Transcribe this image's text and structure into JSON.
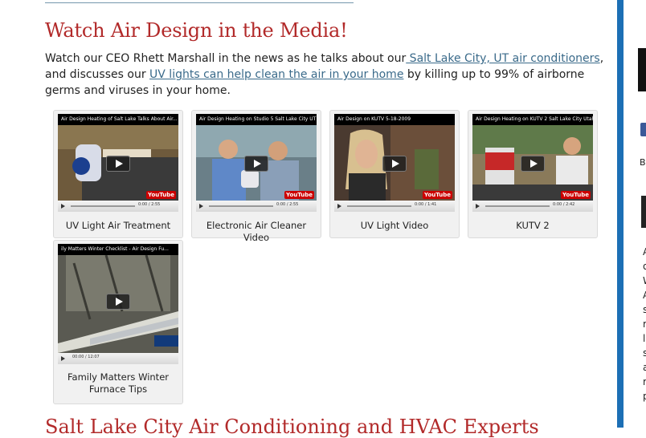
{
  "section": {
    "title": "Watch Air Design in the Media!",
    "intro_start": "Watch our CEO Rhett Marshall in the news as he talks about our",
    "link_ac": " Salt Lake City, UT air conditioners",
    "intro_mid": ", and discusses our ",
    "link_uv": "UV lights can help clean the air in your home",
    "intro_end": " by killing up to 99% of airborne germs and viruses in your home."
  },
  "videos": [
    {
      "title": "Air Design Heating of Salt Lake Talks About Air...",
      "caption": "UV Light Air Treatment",
      "time": "0:00 / 2:55"
    },
    {
      "title": "Air Design Heating on Studio 5 Salt Lake City UT",
      "caption": "Electronic Air Cleaner Video",
      "time": "0:00 / 2:55"
    },
    {
      "title": "Air Design on KUTV 5-18-2009",
      "caption": "UV Light Video",
      "time": "0:00 / 1:41"
    },
    {
      "title": "Air Design Heating on KUTV 2 Salt Lake City Utah",
      "caption": "KUTV 2",
      "time": "0:00 / 2:42"
    },
    {
      "title": "ily Matters Winter Checklist - Air Design Fu...",
      "caption": "Family Matters Winter Furnace Tips",
      "time": "00:00 / 12:07"
    }
  ],
  "youtube_label": "YouTube",
  "next_heading": "Salt Lake City Air Conditioning and HVAC Experts",
  "sidebar": {
    "b_letter": "B",
    "letters": [
      "A",
      "o",
      "W",
      "A",
      "s",
      "r",
      "l",
      "s",
      "a",
      "r",
      "p"
    ]
  },
  "colors": {
    "heading": "#b22a2a",
    "link": "#3a6a8a",
    "sidebar_border": "#1c6fb5"
  }
}
